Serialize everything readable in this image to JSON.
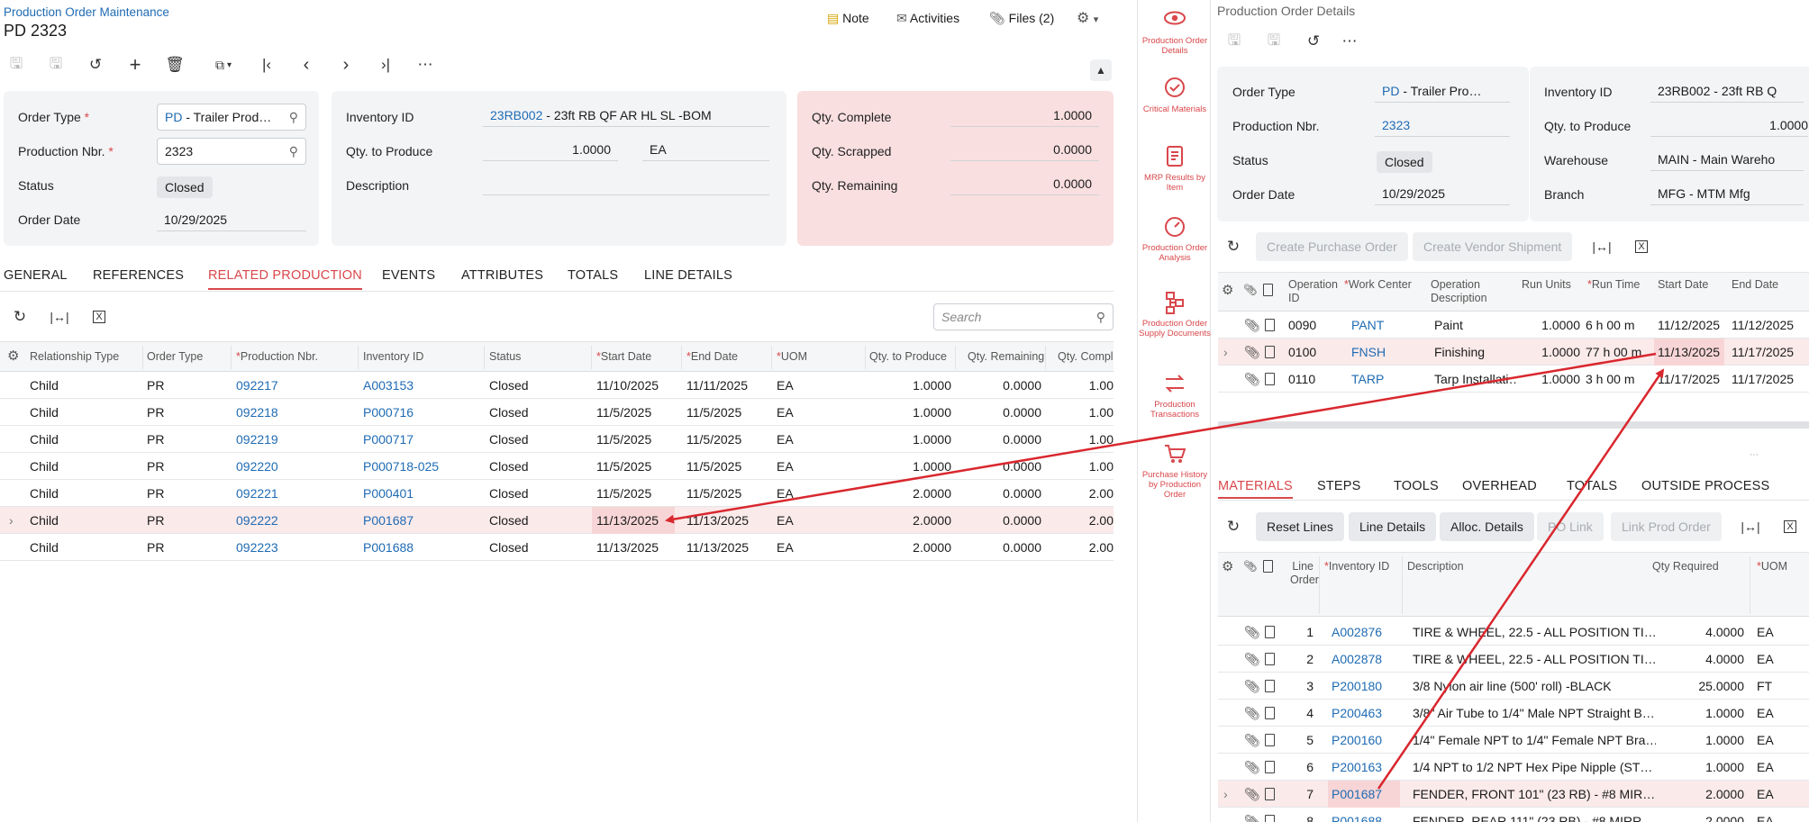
{
  "left": {
    "breadcrumb": "Production Order Maintenance",
    "title": "PD 2323",
    "top_actions": {
      "note": "Note",
      "activities": "Activities",
      "files": "Files (2)"
    },
    "summary": {
      "order_type_label": "Order Type",
      "order_type_code": "PD",
      "order_type_desc": " - Trailer Prod…",
      "production_nbr_label": "Production Nbr.",
      "production_nbr": "2323",
      "status_label": "Status",
      "status": "Closed",
      "order_date_label": "Order Date",
      "order_date": "10/29/2025",
      "inventory_id_label": "Inventory ID",
      "inventory_id_code": "23RB002",
      "inventory_id_desc": " - 23ft RB QF AR HL SL -BOM",
      "qty_to_produce_label": "Qty. to Produce",
      "qty_to_produce": "1.0000",
      "uom": "EA",
      "description_label": "Description",
      "qty_complete_label": "Qty. Complete",
      "qty_complete": "1.0000",
      "qty_scrapped_label": "Qty. Scrapped",
      "qty_scrapped": "0.0000",
      "qty_remaining_label": "Qty. Remaining",
      "qty_remaining": "0.0000"
    },
    "tabs": [
      "GENERAL",
      "REFERENCES",
      "RELATED PRODUCTION",
      "EVENTS",
      "ATTRIBUTES",
      "TOTALS",
      "LINE DETAILS"
    ],
    "search_placeholder": "Search",
    "grid_headers": [
      "Relationship Type",
      "Order Type",
      "Production Nbr.",
      "Inventory ID",
      "Status",
      "Start Date",
      "End Date",
      "UOM",
      "Qty. to Produce",
      "Qty. Remaining",
      "Qty. Compl"
    ],
    "rows": [
      [
        "Child",
        "PR",
        "092217",
        "A003153",
        "Closed",
        "11/10/2025",
        "11/11/2025",
        "EA",
        "1.0000",
        "0.0000",
        "1.00"
      ],
      [
        "Child",
        "PR",
        "092218",
        "P000716",
        "Closed",
        "11/5/2025",
        "11/5/2025",
        "EA",
        "1.0000",
        "0.0000",
        "1.00"
      ],
      [
        "Child",
        "PR",
        "092219",
        "P000717",
        "Closed",
        "11/5/2025",
        "11/5/2025",
        "EA",
        "1.0000",
        "0.0000",
        "1.00"
      ],
      [
        "Child",
        "PR",
        "092220",
        "P000718-025",
        "Closed",
        "11/5/2025",
        "11/5/2025",
        "EA",
        "1.0000",
        "0.0000",
        "1.00"
      ],
      [
        "Child",
        "PR",
        "092221",
        "P000401",
        "Closed",
        "11/5/2025",
        "11/5/2025",
        "EA",
        "2.0000",
        "0.0000",
        "2.00"
      ],
      [
        "Child",
        "PR",
        "092222",
        "P001687",
        "Closed",
        "11/13/2025",
        "11/13/2025",
        "EA",
        "2.0000",
        "0.0000",
        "2.00"
      ],
      [
        "Child",
        "PR",
        "092223",
        "P001688",
        "Closed",
        "11/13/2025",
        "11/13/2025",
        "EA",
        "2.0000",
        "0.0000",
        "2.00"
      ]
    ]
  },
  "sidebar": [
    "Production Order Details",
    "Critical Materials",
    "MRP Results by Item",
    "Production Order Analysis",
    "Production Order Supply Documents",
    "Production Transactions",
    "Purchase History by Production Order"
  ],
  "right": {
    "title": "Production Order Details",
    "summary": {
      "order_type_label": "Order Type",
      "order_type_code": "PD",
      "order_type_desc": " - Trailer Pro…",
      "production_nbr_label": "Production Nbr.",
      "production_nbr": "2323",
      "status_label": "Status",
      "status": "Closed",
      "order_date_label": "Order Date",
      "order_date": "10/29/2025",
      "inventory_id_label": "Inventory ID",
      "inventory_id": "23RB002 - 23ft RB Q",
      "qty_to_produce_label": "Qty. to Produce",
      "qty_to_produce": "1.0000",
      "warehouse_label": "Warehouse",
      "warehouse": "MAIN - Main Wareho",
      "branch_label": "Branch",
      "branch": "MFG - MTM Mfg"
    },
    "ops_buttons": {
      "create_po": "Create Purchase Order",
      "create_vs": "Create Vendor Shipment"
    },
    "ops_headers": [
      "Operation ID",
      "Work Center",
      "Operation Description",
      "Run Units",
      "Run Time",
      "Start Date",
      "End Date"
    ],
    "ops_rows": [
      [
        "0090",
        "PANT",
        "Paint",
        "1.0000",
        "6 h 00 m",
        "11/12/2025",
        "11/12/2025"
      ],
      [
        "0100",
        "FNSH",
        "Finishing",
        "1.0000",
        "77 h 00 m",
        "11/13/2025",
        "11/17/2025"
      ],
      [
        "0110",
        "TARP",
        "Tarp Installati…",
        "1.0000",
        "3 h 00 m",
        "11/17/2025",
        "11/17/2025"
      ]
    ],
    "tabs": [
      "MATERIALS",
      "STEPS",
      "TOOLS",
      "OVERHEAD",
      "TOTALS",
      "OUTSIDE PROCESS"
    ],
    "mat_buttons": {
      "reset": "Reset Lines",
      "line_details": "Line Details",
      "alloc": "Alloc. Details",
      "po_link": "PO Link",
      "link_prod": "Link Prod Order"
    },
    "mat_headers": [
      "Line Order",
      "Inventory ID",
      "Description",
      "Qty Required",
      "UOM"
    ],
    "mat_rows": [
      [
        "1",
        "A002876",
        "TIRE & WHEEL, 22.5 - ALL POSITION TI…",
        "4.0000",
        "EA"
      ],
      [
        "2",
        "A002878",
        "TIRE & WHEEL, 22.5 - ALL POSITION TI…",
        "4.0000",
        "EA"
      ],
      [
        "3",
        "P200180",
        "3/8 Nylon air line (500' roll) -BLACK",
        "25.0000",
        "FT"
      ],
      [
        "4",
        "P200463",
        "3/8\" Air Tube to 1/4\" Male NPT Straight B…",
        "1.0000",
        "EA"
      ],
      [
        "5",
        "P200160",
        "1/4\" Female NPT to 1/4\" Female NPT Bra…",
        "1.0000",
        "EA"
      ],
      [
        "6",
        "P200163",
        "1/4 NPT to 1/2 NPT Hex Pipe Nipple (ST…",
        "1.0000",
        "EA"
      ],
      [
        "7",
        "P001687",
        "FENDER, FRONT 101\" (23 RB) - #8 MIR…",
        "2.0000",
        "EA"
      ],
      [
        "8",
        "P001688",
        "FENDER, REAR 111\" (23 RB) - #8 MIRR…",
        "2.0000",
        "EA"
      ]
    ]
  },
  "colors": {
    "accent": "#d9474b",
    "link": "#1f6bb3",
    "arrow": "#d9272e"
  }
}
